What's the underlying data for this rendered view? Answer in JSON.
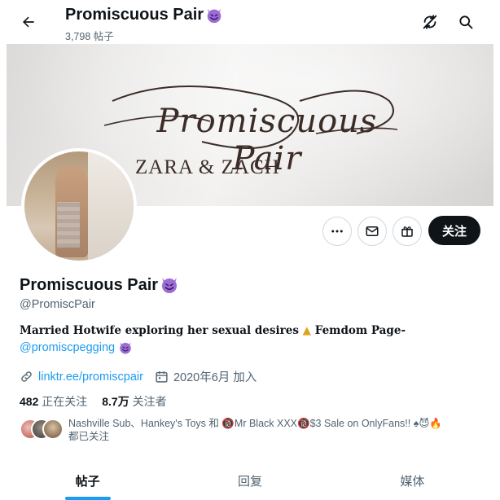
{
  "header": {
    "title": "Promiscuous Pair",
    "title_emoji": "smiling-devil-emoji",
    "post_count": "3,798 帖子",
    "icons": [
      "back-arrow-icon",
      "refresh-off-icon",
      "search-icon"
    ]
  },
  "banner": {
    "script_text": "Promiscuous Pair",
    "subtitle": "ZARA & ZACH"
  },
  "actions": {
    "more_icon": "more-icon",
    "message_icon": "mail-icon",
    "gift_icon": "gift-icon",
    "follow_label": "关注"
  },
  "profile": {
    "name": "Promiscuous Pair",
    "handle": "@PromiscPair",
    "bio_line1": "Married Hotwife exploring her sexual desires",
    "bio_line1_tail": "Femdom Page-",
    "bio_mention": "@promiscpegging",
    "link": "linktr.ee/promiscpair",
    "joined": "2020年6月 加入"
  },
  "counts": {
    "following_value": "482",
    "following_label": "正在关注",
    "followers_value": "8.7万",
    "followers_label": "关注者"
  },
  "followed_by": {
    "text": "Nashville Sub、Hankey's Toys 和 🔞Mr Black XXX🔞$3 Sale on OnlyFans!! ♠😈🔥",
    "suffix": "都已关注"
  },
  "tabs": [
    {
      "label": "帖子",
      "active": true
    },
    {
      "label": "回复",
      "active": false
    },
    {
      "label": "媒体",
      "active": false
    }
  ],
  "colors": {
    "accent": "#1d9bf0",
    "text": "#0f1419",
    "muted": "#536471",
    "devil": "#9b6cd3"
  }
}
